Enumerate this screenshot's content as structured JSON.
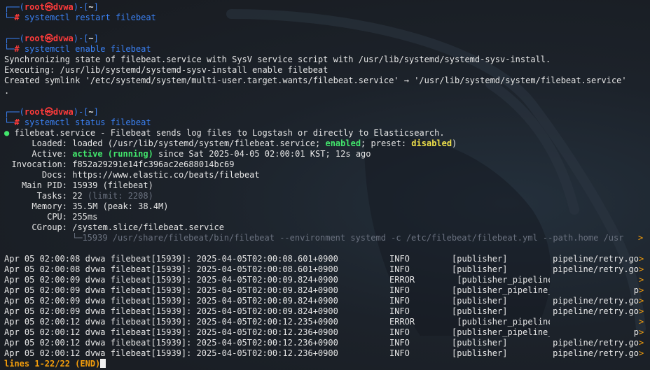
{
  "prompt": {
    "user": "root",
    "at": "㉿",
    "host": "dvwa",
    "dir": "~"
  },
  "blocks": [
    {
      "command": "systemctl restart filebeat",
      "output": []
    },
    {
      "command": "systemctl enable filebeat",
      "output": [
        "Synchronizing state of filebeat.service with SysV service script with /usr/lib/systemd/systemd-sysv-install.",
        "Executing: /usr/lib/systemd/systemd-sysv-install enable filebeat",
        "Created symlink '/etc/systemd/system/multi-user.target.wants/filebeat.service' → '/usr/lib/systemd/system/filebeat.service'",
        "."
      ]
    }
  ],
  "status": {
    "command": "systemctl status filebeat",
    "dot": "●",
    "title": "filebeat.service - Filebeat sends log files to Logstash or directly to Elasticsearch.",
    "loaded_label": "Loaded:",
    "loaded_pre": "loaded (/usr/lib/systemd/system/filebeat.service; ",
    "loaded_enabled": "enabled",
    "loaded_mid": "; preset: ",
    "loaded_disabled": "disabled",
    "loaded_post": ")",
    "active_label": "Active:",
    "active_state": "active (running)",
    "active_rest": " since Sat 2025-04-05 02:00:01 KST; 12s ago",
    "invocation_label": "Invocation:",
    "invocation": "f852a29291e14fc396ac2e688014bc69",
    "docs_label": "Docs:",
    "docs": "https://www.elastic.co/beats/filebeat",
    "pid_label": "Main PID:",
    "pid": "15939 (filebeat)",
    "tasks_label": "Tasks:",
    "tasks": "22",
    "tasks_limit": " (limit: 2208)",
    "memory_label": "Memory:",
    "memory": "35.5M (peak: 38.4M)",
    "cpu_label": "CPU:",
    "cpu": "255ms",
    "cgroup_label": "CGroup:",
    "cgroup": "/system.slice/filebeat.service",
    "cgroup_proc": "└─15939 /usr/share/filebeat/bin/filebeat --environment systemd -c /etc/filebeat/filebeat.yml --path.home /usr",
    "more": ">"
  },
  "log_lines": [
    {
      "prefix": "Apr 05 02:00:08 dvwa filebeat[15939]: 2025-04-05T02:00:08.601+0900",
      "level": "INFO",
      "component": "[publisher]",
      "source": "pipeline/retry.go",
      "more": ">"
    },
    {
      "prefix": "Apr 05 02:00:08 dvwa filebeat[15939]: 2025-04-05T02:00:08.601+0900",
      "level": "INFO",
      "component": "[publisher]",
      "source": "pipeline/retry.go",
      "more": ">"
    },
    {
      "prefix": "Apr 05 02:00:09 dvwa filebeat[15939]: 2025-04-05T02:00:09.824+0900",
      "level": "ERROR",
      "component": " [publisher_pipeline_output]",
      "source": "",
      "more": ">"
    },
    {
      "prefix": "Apr 05 02:00:09 dvwa filebeat[15939]: 2025-04-05T02:00:09.824+0900",
      "level": "INFO",
      "component": "[publisher_pipeline_output]",
      "source": "p",
      "more": ">"
    },
    {
      "prefix": "Apr 05 02:00:09 dvwa filebeat[15939]: 2025-04-05T02:00:09.824+0900",
      "level": "INFO",
      "component": "[publisher]",
      "source": "pipeline/retry.go",
      "more": ">"
    },
    {
      "prefix": "Apr 05 02:00:09 dvwa filebeat[15939]: 2025-04-05T02:00:09.824+0900",
      "level": "INFO",
      "component": "[publisher]",
      "source": "pipeline/retry.go",
      "more": ">"
    },
    {
      "prefix": "Apr 05 02:00:12 dvwa filebeat[15939]: 2025-04-05T02:00:12.235+0900",
      "level": "ERROR",
      "component": " [publisher_pipeline_output]",
      "source": "",
      "more": ">"
    },
    {
      "prefix": "Apr 05 02:00:12 dvwa filebeat[15939]: 2025-04-05T02:00:12.236+0900",
      "level": "INFO",
      "component": "[publisher_pipeline_output]",
      "source": "p",
      "more": ">"
    },
    {
      "prefix": "Apr 05 02:00:12 dvwa filebeat[15939]: 2025-04-05T02:00:12.236+0900",
      "level": "INFO",
      "component": "[publisher]",
      "source": "pipeline/retry.go",
      "more": ">"
    },
    {
      "prefix": "Apr 05 02:00:12 dvwa filebeat[15939]: 2025-04-05T02:00:12.236+0900",
      "level": "INFO",
      "component": "[publisher]",
      "source": "pipeline/retry.go",
      "more": ">"
    }
  ],
  "pager": {
    "text": "lines 1-22/22 (END)"
  },
  "colors": {
    "background": "#1b1f25",
    "prompt_blue": "#3b82f6",
    "user_red": "#ff3b3b",
    "active_green": "#42e66c",
    "disabled_yellow": "#f0e04a",
    "pager_orange": "#f59e0b"
  }
}
